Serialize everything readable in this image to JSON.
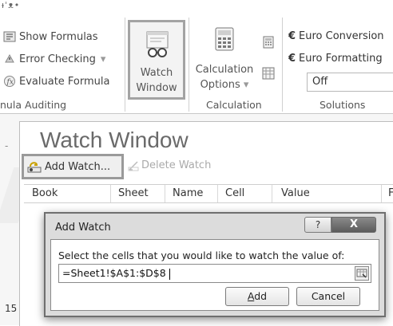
{
  "ribbon": {
    "partial_top": "ɟˈᴥ•",
    "formula_auditing": {
      "show_formulas": "Show Formulas",
      "error_checking": "Error Checking",
      "error_checking_arrow": "▾",
      "evaluate_formula": "Evaluate Formula",
      "group_label": "nula Auditing"
    },
    "watch_window_button": {
      "line1": "Watch",
      "line2": "Window"
    },
    "calculation": {
      "options_line1": "Calculation",
      "options_line2": "Options",
      "options_arrow": "▾",
      "group_label": "Calculation"
    },
    "solutions": {
      "euro_conversion": "Euro Conversion",
      "euro_formatting": "Euro Formatting",
      "euro_symbol": "€",
      "off_value": "Off",
      "group_label": "Solutions"
    }
  },
  "watch_window": {
    "title": "Watch Window",
    "add_watch": "Add Watch...",
    "delete_watch": "Delete Watch",
    "columns": [
      "Book",
      "Sheet",
      "Name",
      "Cell",
      "Value",
      "F"
    ]
  },
  "sheet": {
    "row_number": "15"
  },
  "dialog": {
    "title": "Add Watch",
    "help": "?",
    "close": "X",
    "prompt": "Select the cells that you would like to watch the value of:",
    "input_value": "=Sheet1!$A$1:$D$8",
    "add_button": "Add",
    "cancel_button": "Cancel"
  },
  "icons": {
    "show_formulas": "show-formulas-icon",
    "error_checking": "error-checking-icon",
    "evaluate_formula": "evaluate-formula-icon",
    "watch_window": "glasses-icon",
    "calculator": "calculator-icon",
    "calc_now": "calculate-now-icon",
    "calc_sheet": "calculate-sheet-icon",
    "euro": "euro-icon",
    "add_watch": "add-watch-icon",
    "delete_watch": "delete-watch-icon",
    "collapse_dialog": "collapse-dialog-icon"
  },
  "colors": {
    "highlight_border": "#a3a3a3",
    "title_grey": "#6a6a6a",
    "dialog_close": "#5c5c5c"
  }
}
